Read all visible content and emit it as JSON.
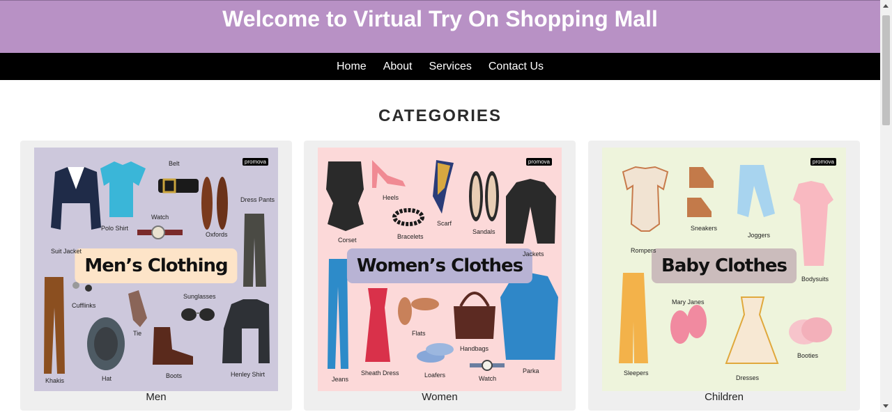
{
  "header": {
    "title": "Welcome to Virtual Try On Shopping Mall"
  },
  "nav": {
    "items": [
      "Home",
      "About",
      "Services",
      "Contact Us"
    ]
  },
  "section": {
    "title": "CATEGORIES"
  },
  "categories": [
    {
      "label": "Men",
      "banner": "Men’s Clothing",
      "badge": "promova",
      "bg": "#cdc8dc",
      "banner_bg": "#fde4c8",
      "items": [
        "Suit Jacket",
        "Polo Shirt",
        "Belt",
        "Watch",
        "Oxfords",
        "Dress Pants",
        "Khakis",
        "Cufflinks",
        "Hat",
        "Tie",
        "Sunglasses",
        "Boots",
        "Henley Shirt"
      ]
    },
    {
      "label": "Women",
      "banner": "Women’s Clothes",
      "badge": "promova",
      "bg": "#fcd9d9",
      "banner_bg": "#b8b3d4",
      "items": [
        "Corset",
        "Heels",
        "Bracelets",
        "Scarf",
        "Sandals",
        "Jackets",
        "Jeans",
        "Sheath Dress",
        "Flats",
        "Handbags",
        "Loafers",
        "Watch",
        "Parka"
      ]
    },
    {
      "label": "Children",
      "banner": "Baby Clothes",
      "badge": "promova",
      "bg": "#eef4dc",
      "banner_bg": "#cbbcbc",
      "items": [
        "Rompers",
        "Sneakers",
        "Joggers",
        "Bodysuits",
        "Mary Janes",
        "Sleepers",
        "Dresses",
        "Booties"
      ]
    }
  ]
}
